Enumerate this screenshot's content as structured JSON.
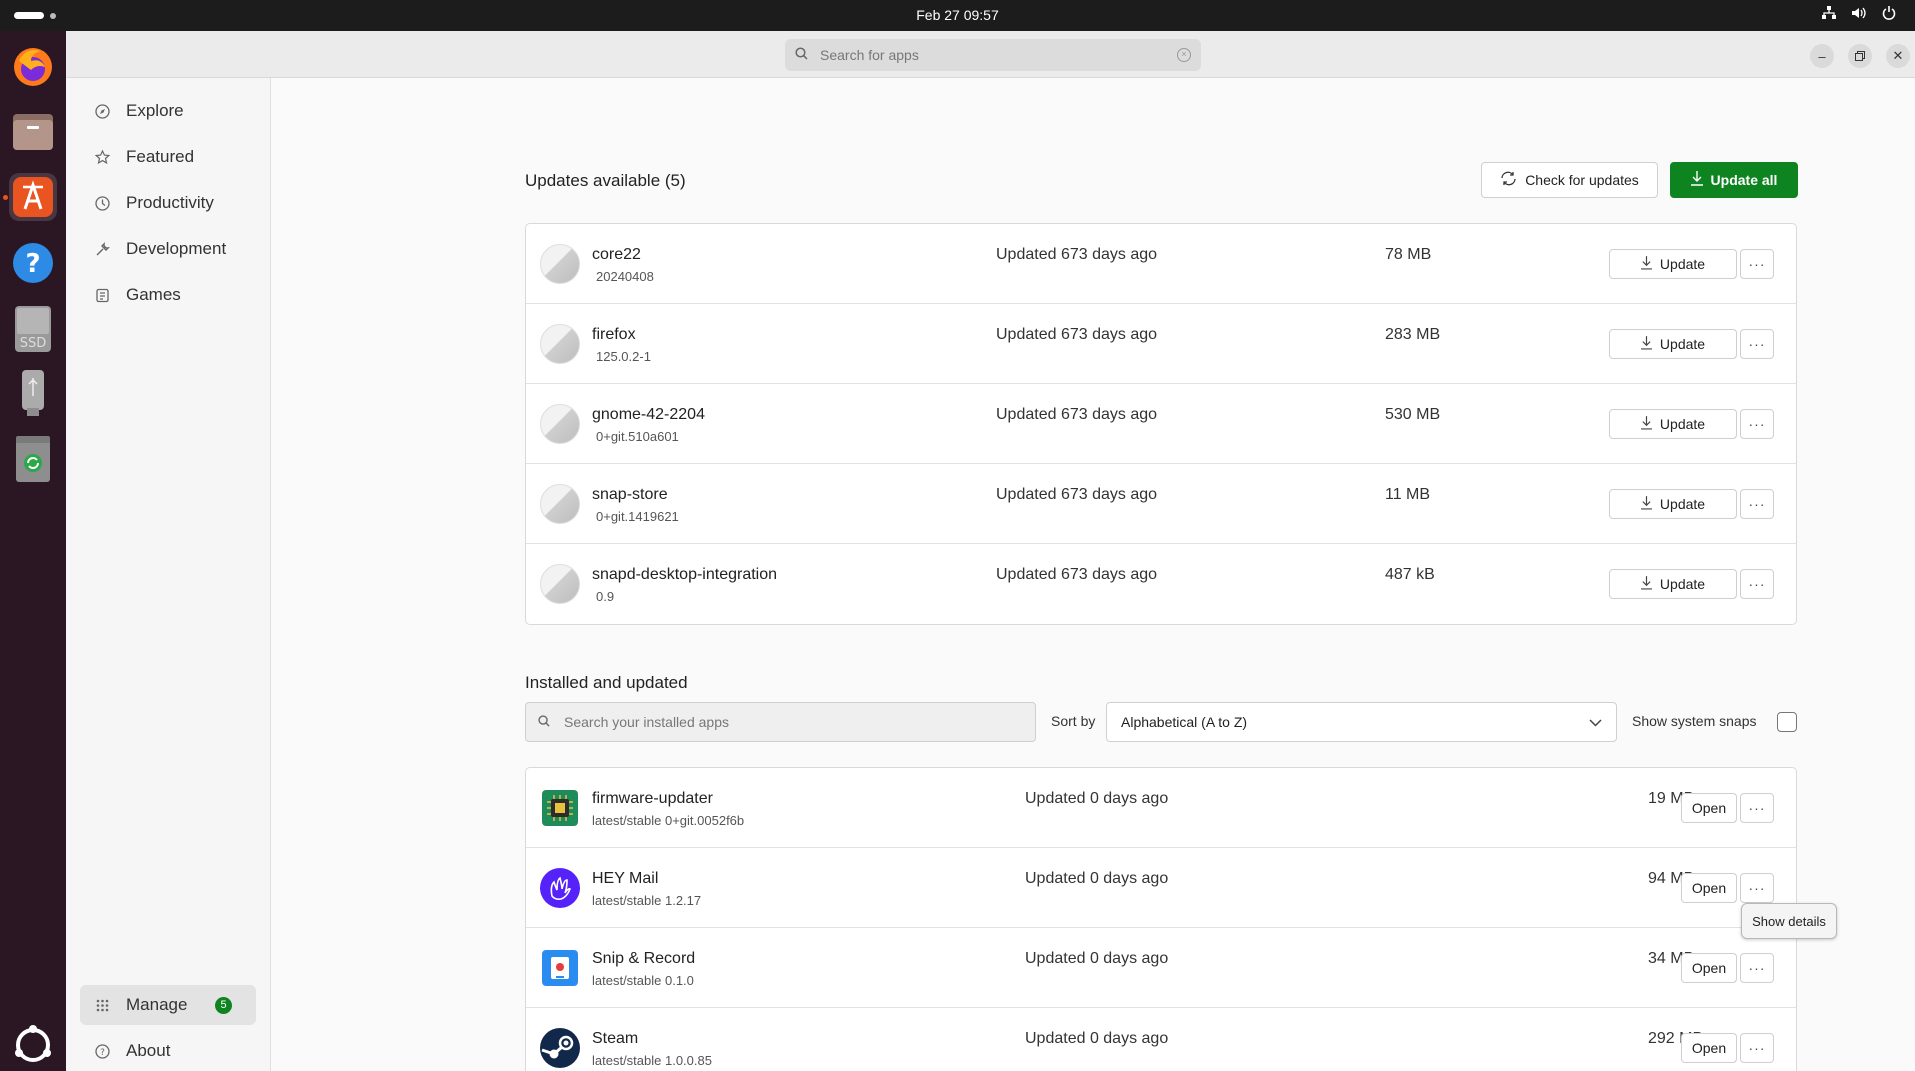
{
  "topbar": {
    "clock": "Feb 27  09:57"
  },
  "search": {
    "placeholder": "Search for apps"
  },
  "sidebar": {
    "items": [
      {
        "label": "Explore",
        "icon": "compass-icon"
      },
      {
        "label": "Featured",
        "icon": "star-icon"
      },
      {
        "label": "Productivity",
        "icon": "clock-icon"
      },
      {
        "label": "Development",
        "icon": "wrench-icon"
      },
      {
        "label": "Games",
        "icon": "gamepad-icon"
      }
    ],
    "manage": {
      "label": "Manage",
      "badge": "5"
    },
    "about": {
      "label": "About"
    }
  },
  "updates": {
    "title": "Updates available (5)",
    "check_label": "Check for updates",
    "update_all_label": "Update all",
    "rows": [
      {
        "name": "core22",
        "version": "20240408",
        "status": "Updated 673 days ago",
        "size": "78 MB",
        "action": "Update"
      },
      {
        "name": "firefox",
        "version": "125.0.2-1",
        "status": "Updated 673 days ago",
        "size": "283 MB",
        "action": "Update"
      },
      {
        "name": "gnome-42-2204",
        "version": "0+git.510a601",
        "status": "Updated 673 days ago",
        "size": "530 MB",
        "action": "Update"
      },
      {
        "name": "snap-store",
        "version": "0+git.1419621",
        "status": "Updated 673 days ago",
        "size": "11 MB",
        "action": "Update"
      },
      {
        "name": "snapd-desktop-integration",
        "version": "0.9",
        "status": "Updated 673 days ago",
        "size": "487 kB",
        "action": "Update"
      }
    ],
    "more_label": "···"
  },
  "installed": {
    "title": "Installed and updated",
    "search_placeholder": "Search your installed apps",
    "sort_label": "Sort by",
    "sort_value": "Alphabetical (A to Z)",
    "system_snaps_label": "Show system snaps",
    "rows": [
      {
        "name": "firmware-updater",
        "version": "latest/stable 0+git.0052f6b",
        "status": "Updated 0 days ago",
        "size": "19 MB",
        "action": "Open"
      },
      {
        "name": "HEY Mail",
        "version": "latest/stable 1.2.17",
        "status": "Updated 0 days ago",
        "size": "94 MB",
        "action": "Open"
      },
      {
        "name": "Snip & Record",
        "version": "latest/stable 0.1.0",
        "status": "Updated 0 days ago",
        "size": "34 MB",
        "action": "Open"
      },
      {
        "name": "Steam",
        "version": "latest/stable 1.0.0.85",
        "status": "Updated 0 days ago",
        "size": "292 MB",
        "action": "Open"
      }
    ]
  },
  "tooltip": {
    "text": "Show details"
  },
  "colors": {
    "accent_green": "#0e8420",
    "ubuntu_orange": "#e95420",
    "dock_bg": "#2b1624"
  }
}
